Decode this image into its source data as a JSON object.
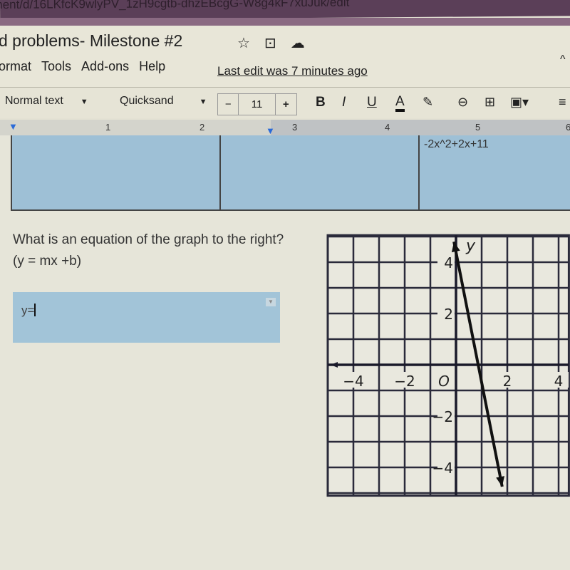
{
  "browser": {
    "url": "ument/d/16LKfcK9wlyPV_1zH9cgtb-dhzEBcgG-W8g4kF7xuJuk/edit"
  },
  "doc": {
    "title": "d problems- Milestone #2",
    "title_icons": [
      "star-icon",
      "move-to-folder-icon",
      "cloud-saved-icon"
    ],
    "menu": [
      "ormat",
      "Tools",
      "Add-ons",
      "Help"
    ],
    "last_edit": "Last edit was 7 minutes ago"
  },
  "toolbar": {
    "style": "Normal text",
    "font": "Quicksand",
    "minus": "−",
    "font_size": "11",
    "plus": "+",
    "bold": "B",
    "italic": "I",
    "underline": "U",
    "text_color": "A"
  },
  "ruler": {
    "numbers": [
      "1",
      "2",
      "3",
      "4",
      "5",
      "6"
    ]
  },
  "table": {
    "cell_text": "-2x^2+2x+11"
  },
  "question": {
    "text": "What is an equation of the graph to the right? (y = mx +b)",
    "answer_value": "y="
  },
  "graph": {
    "axis_label_y": "y",
    "origin_label": "O",
    "x_ticks": [
      "−4",
      "−2",
      "2",
      "4"
    ],
    "y_ticks": [
      "4",
      "2",
      "−2",
      "−4"
    ],
    "x_range": [
      -5,
      4.4
    ],
    "y_range": [
      -5.1,
      5.05
    ],
    "line": {
      "start": [
        -0.08,
        4.8
      ],
      "end": [
        1.8,
        -4.75
      ]
    }
  }
}
